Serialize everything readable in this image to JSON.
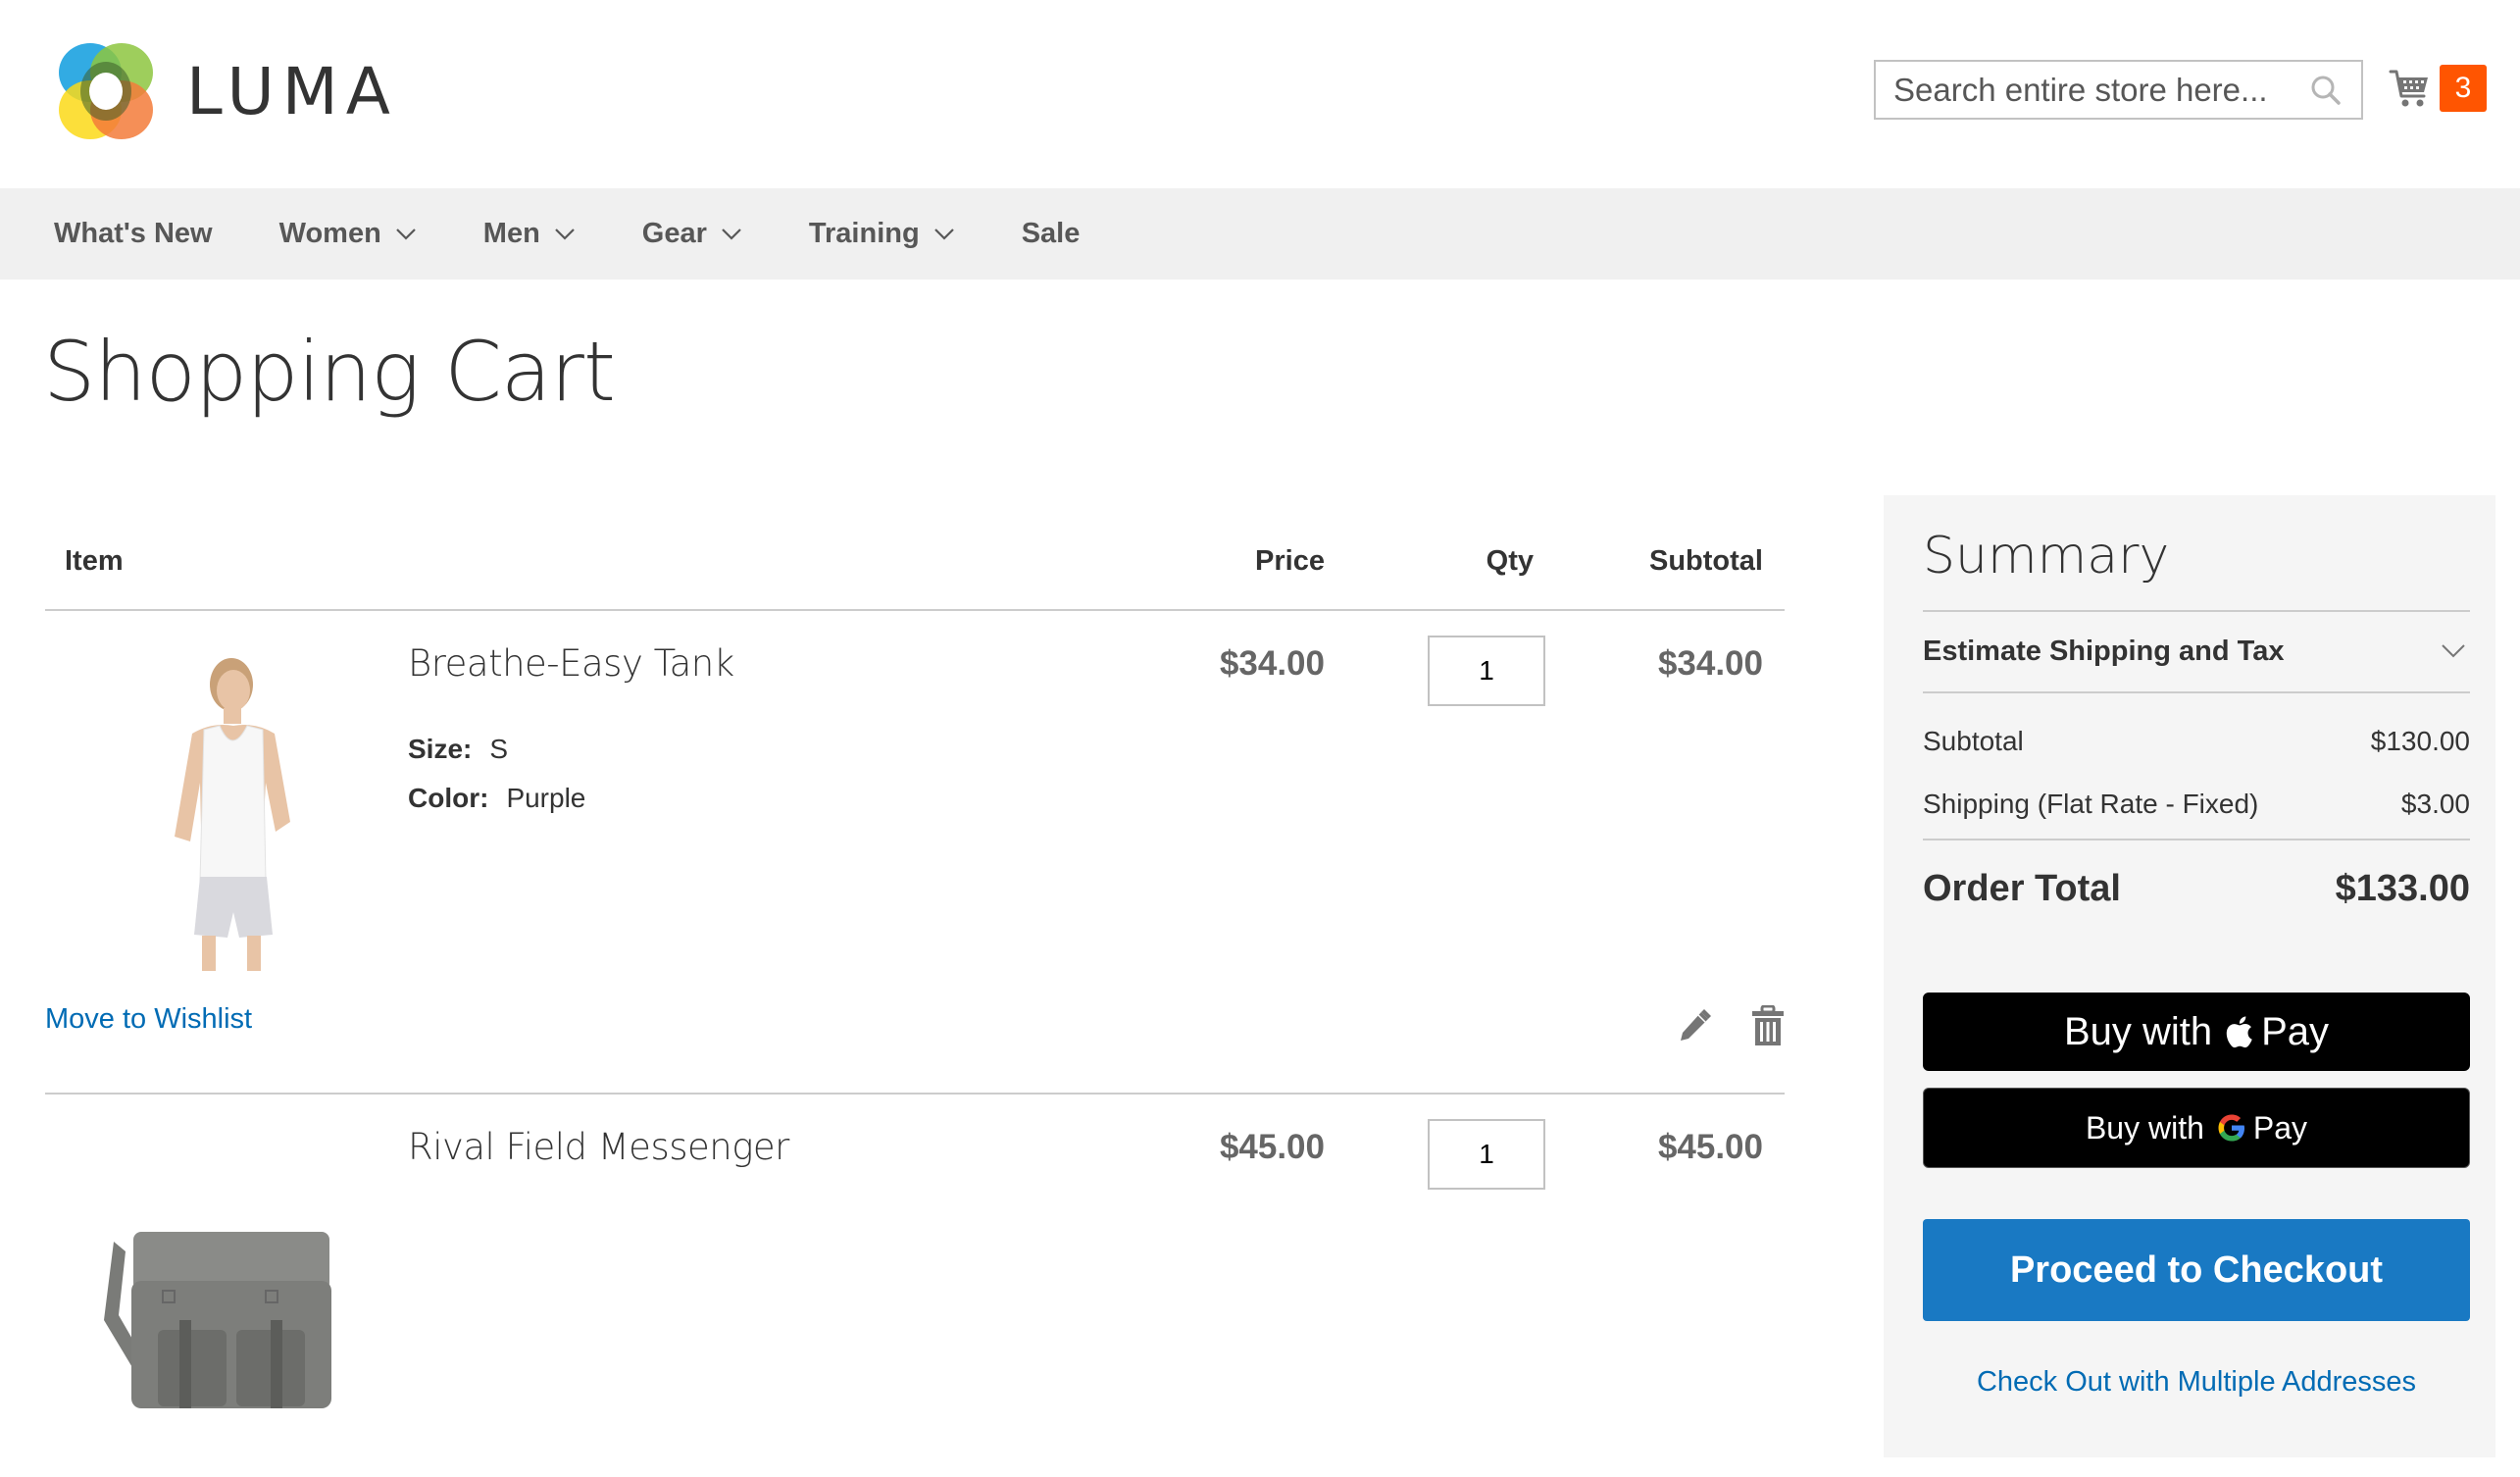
{
  "header": {
    "logo_text": "LUMA",
    "search": {
      "placeholder": "Search entire store here...",
      "value": ""
    },
    "cart": {
      "count": "3"
    }
  },
  "nav": {
    "items": [
      {
        "label": "What's New",
        "has_dropdown": false
      },
      {
        "label": "Women",
        "has_dropdown": true
      },
      {
        "label": "Men",
        "has_dropdown": true
      },
      {
        "label": "Gear",
        "has_dropdown": true
      },
      {
        "label": "Training",
        "has_dropdown": true
      },
      {
        "label": "Sale",
        "has_dropdown": false
      }
    ]
  },
  "page": {
    "title": "Shopping Cart"
  },
  "cart_table": {
    "headers": {
      "item": "Item",
      "price": "Price",
      "qty": "Qty",
      "subtotal": "Subtotal"
    },
    "items": [
      {
        "name": "Breathe-Easy Tank",
        "image": "white-tank-top-photo",
        "options": [
          {
            "label": "Size:",
            "value": "S"
          },
          {
            "label": "Color:",
            "value": "Purple"
          }
        ],
        "price": "$34.00",
        "qty": "1",
        "subtotal": "$34.00",
        "actions": {
          "wishlist": "Move to Wishlist",
          "edit_icon": "pencil-icon",
          "delete_icon": "trash-icon"
        }
      },
      {
        "name": "Rival Field Messenger",
        "image": "gray-messenger-bag-photo",
        "options": [],
        "price": "$45.00",
        "qty": "1",
        "subtotal": "$45.00"
      }
    ]
  },
  "summary": {
    "title": "Summary",
    "estimate_label": "Estimate Shipping and Tax",
    "subtotal_label": "Subtotal",
    "subtotal_value": "$130.00",
    "shipping_label": "Shipping (Flat Rate - Fixed)",
    "shipping_value": "$3.00",
    "order_total_label": "Order Total",
    "order_total_value": "$133.00",
    "apple_pay": {
      "prefix": "Buy with",
      "suffix": "Pay"
    },
    "google_pay": {
      "prefix": "Buy with",
      "suffix": "Pay"
    },
    "checkout_label": "Proceed to Checkout",
    "multi_address_label": "Check Out with Multiple Addresses"
  },
  "colors": {
    "accent_blue": "#1979c3",
    "link_blue": "#006bb4",
    "badge_orange": "#ff5501",
    "nav_bg": "#f0f0f0",
    "summary_bg": "#f5f5f5"
  }
}
